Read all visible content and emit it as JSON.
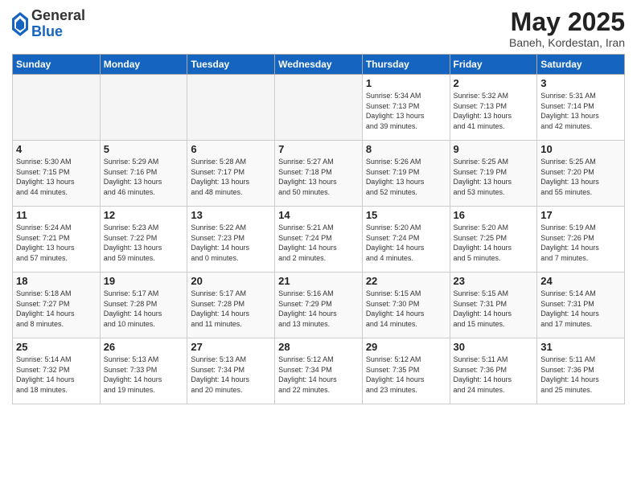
{
  "logo": {
    "general": "General",
    "blue": "Blue"
  },
  "header": {
    "month": "May 2025",
    "location": "Baneh, Kordestan, Iran"
  },
  "days_of_week": [
    "Sunday",
    "Monday",
    "Tuesday",
    "Wednesday",
    "Thursday",
    "Friday",
    "Saturday"
  ],
  "weeks": [
    [
      {
        "day": "",
        "info": ""
      },
      {
        "day": "",
        "info": ""
      },
      {
        "day": "",
        "info": ""
      },
      {
        "day": "",
        "info": ""
      },
      {
        "day": "1",
        "info": "Sunrise: 5:34 AM\nSunset: 7:13 PM\nDaylight: 13 hours\nand 39 minutes."
      },
      {
        "day": "2",
        "info": "Sunrise: 5:32 AM\nSunset: 7:13 PM\nDaylight: 13 hours\nand 41 minutes."
      },
      {
        "day": "3",
        "info": "Sunrise: 5:31 AM\nSunset: 7:14 PM\nDaylight: 13 hours\nand 42 minutes."
      }
    ],
    [
      {
        "day": "4",
        "info": "Sunrise: 5:30 AM\nSunset: 7:15 PM\nDaylight: 13 hours\nand 44 minutes."
      },
      {
        "day": "5",
        "info": "Sunrise: 5:29 AM\nSunset: 7:16 PM\nDaylight: 13 hours\nand 46 minutes."
      },
      {
        "day": "6",
        "info": "Sunrise: 5:28 AM\nSunset: 7:17 PM\nDaylight: 13 hours\nand 48 minutes."
      },
      {
        "day": "7",
        "info": "Sunrise: 5:27 AM\nSunset: 7:18 PM\nDaylight: 13 hours\nand 50 minutes."
      },
      {
        "day": "8",
        "info": "Sunrise: 5:26 AM\nSunset: 7:19 PM\nDaylight: 13 hours\nand 52 minutes."
      },
      {
        "day": "9",
        "info": "Sunrise: 5:25 AM\nSunset: 7:19 PM\nDaylight: 13 hours\nand 53 minutes."
      },
      {
        "day": "10",
        "info": "Sunrise: 5:25 AM\nSunset: 7:20 PM\nDaylight: 13 hours\nand 55 minutes."
      }
    ],
    [
      {
        "day": "11",
        "info": "Sunrise: 5:24 AM\nSunset: 7:21 PM\nDaylight: 13 hours\nand 57 minutes."
      },
      {
        "day": "12",
        "info": "Sunrise: 5:23 AM\nSunset: 7:22 PM\nDaylight: 13 hours\nand 59 minutes."
      },
      {
        "day": "13",
        "info": "Sunrise: 5:22 AM\nSunset: 7:23 PM\nDaylight: 14 hours\nand 0 minutes."
      },
      {
        "day": "14",
        "info": "Sunrise: 5:21 AM\nSunset: 7:24 PM\nDaylight: 14 hours\nand 2 minutes."
      },
      {
        "day": "15",
        "info": "Sunrise: 5:20 AM\nSunset: 7:24 PM\nDaylight: 14 hours\nand 4 minutes."
      },
      {
        "day": "16",
        "info": "Sunrise: 5:20 AM\nSunset: 7:25 PM\nDaylight: 14 hours\nand 5 minutes."
      },
      {
        "day": "17",
        "info": "Sunrise: 5:19 AM\nSunset: 7:26 PM\nDaylight: 14 hours\nand 7 minutes."
      }
    ],
    [
      {
        "day": "18",
        "info": "Sunrise: 5:18 AM\nSunset: 7:27 PM\nDaylight: 14 hours\nand 8 minutes."
      },
      {
        "day": "19",
        "info": "Sunrise: 5:17 AM\nSunset: 7:28 PM\nDaylight: 14 hours\nand 10 minutes."
      },
      {
        "day": "20",
        "info": "Sunrise: 5:17 AM\nSunset: 7:28 PM\nDaylight: 14 hours\nand 11 minutes."
      },
      {
        "day": "21",
        "info": "Sunrise: 5:16 AM\nSunset: 7:29 PM\nDaylight: 14 hours\nand 13 minutes."
      },
      {
        "day": "22",
        "info": "Sunrise: 5:15 AM\nSunset: 7:30 PM\nDaylight: 14 hours\nand 14 minutes."
      },
      {
        "day": "23",
        "info": "Sunrise: 5:15 AM\nSunset: 7:31 PM\nDaylight: 14 hours\nand 15 minutes."
      },
      {
        "day": "24",
        "info": "Sunrise: 5:14 AM\nSunset: 7:31 PM\nDaylight: 14 hours\nand 17 minutes."
      }
    ],
    [
      {
        "day": "25",
        "info": "Sunrise: 5:14 AM\nSunset: 7:32 PM\nDaylight: 14 hours\nand 18 minutes."
      },
      {
        "day": "26",
        "info": "Sunrise: 5:13 AM\nSunset: 7:33 PM\nDaylight: 14 hours\nand 19 minutes."
      },
      {
        "day": "27",
        "info": "Sunrise: 5:13 AM\nSunset: 7:34 PM\nDaylight: 14 hours\nand 20 minutes."
      },
      {
        "day": "28",
        "info": "Sunrise: 5:12 AM\nSunset: 7:34 PM\nDaylight: 14 hours\nand 22 minutes."
      },
      {
        "day": "29",
        "info": "Sunrise: 5:12 AM\nSunset: 7:35 PM\nDaylight: 14 hours\nand 23 minutes."
      },
      {
        "day": "30",
        "info": "Sunrise: 5:11 AM\nSunset: 7:36 PM\nDaylight: 14 hours\nand 24 minutes."
      },
      {
        "day": "31",
        "info": "Sunrise: 5:11 AM\nSunset: 7:36 PM\nDaylight: 14 hours\nand 25 minutes."
      }
    ]
  ]
}
